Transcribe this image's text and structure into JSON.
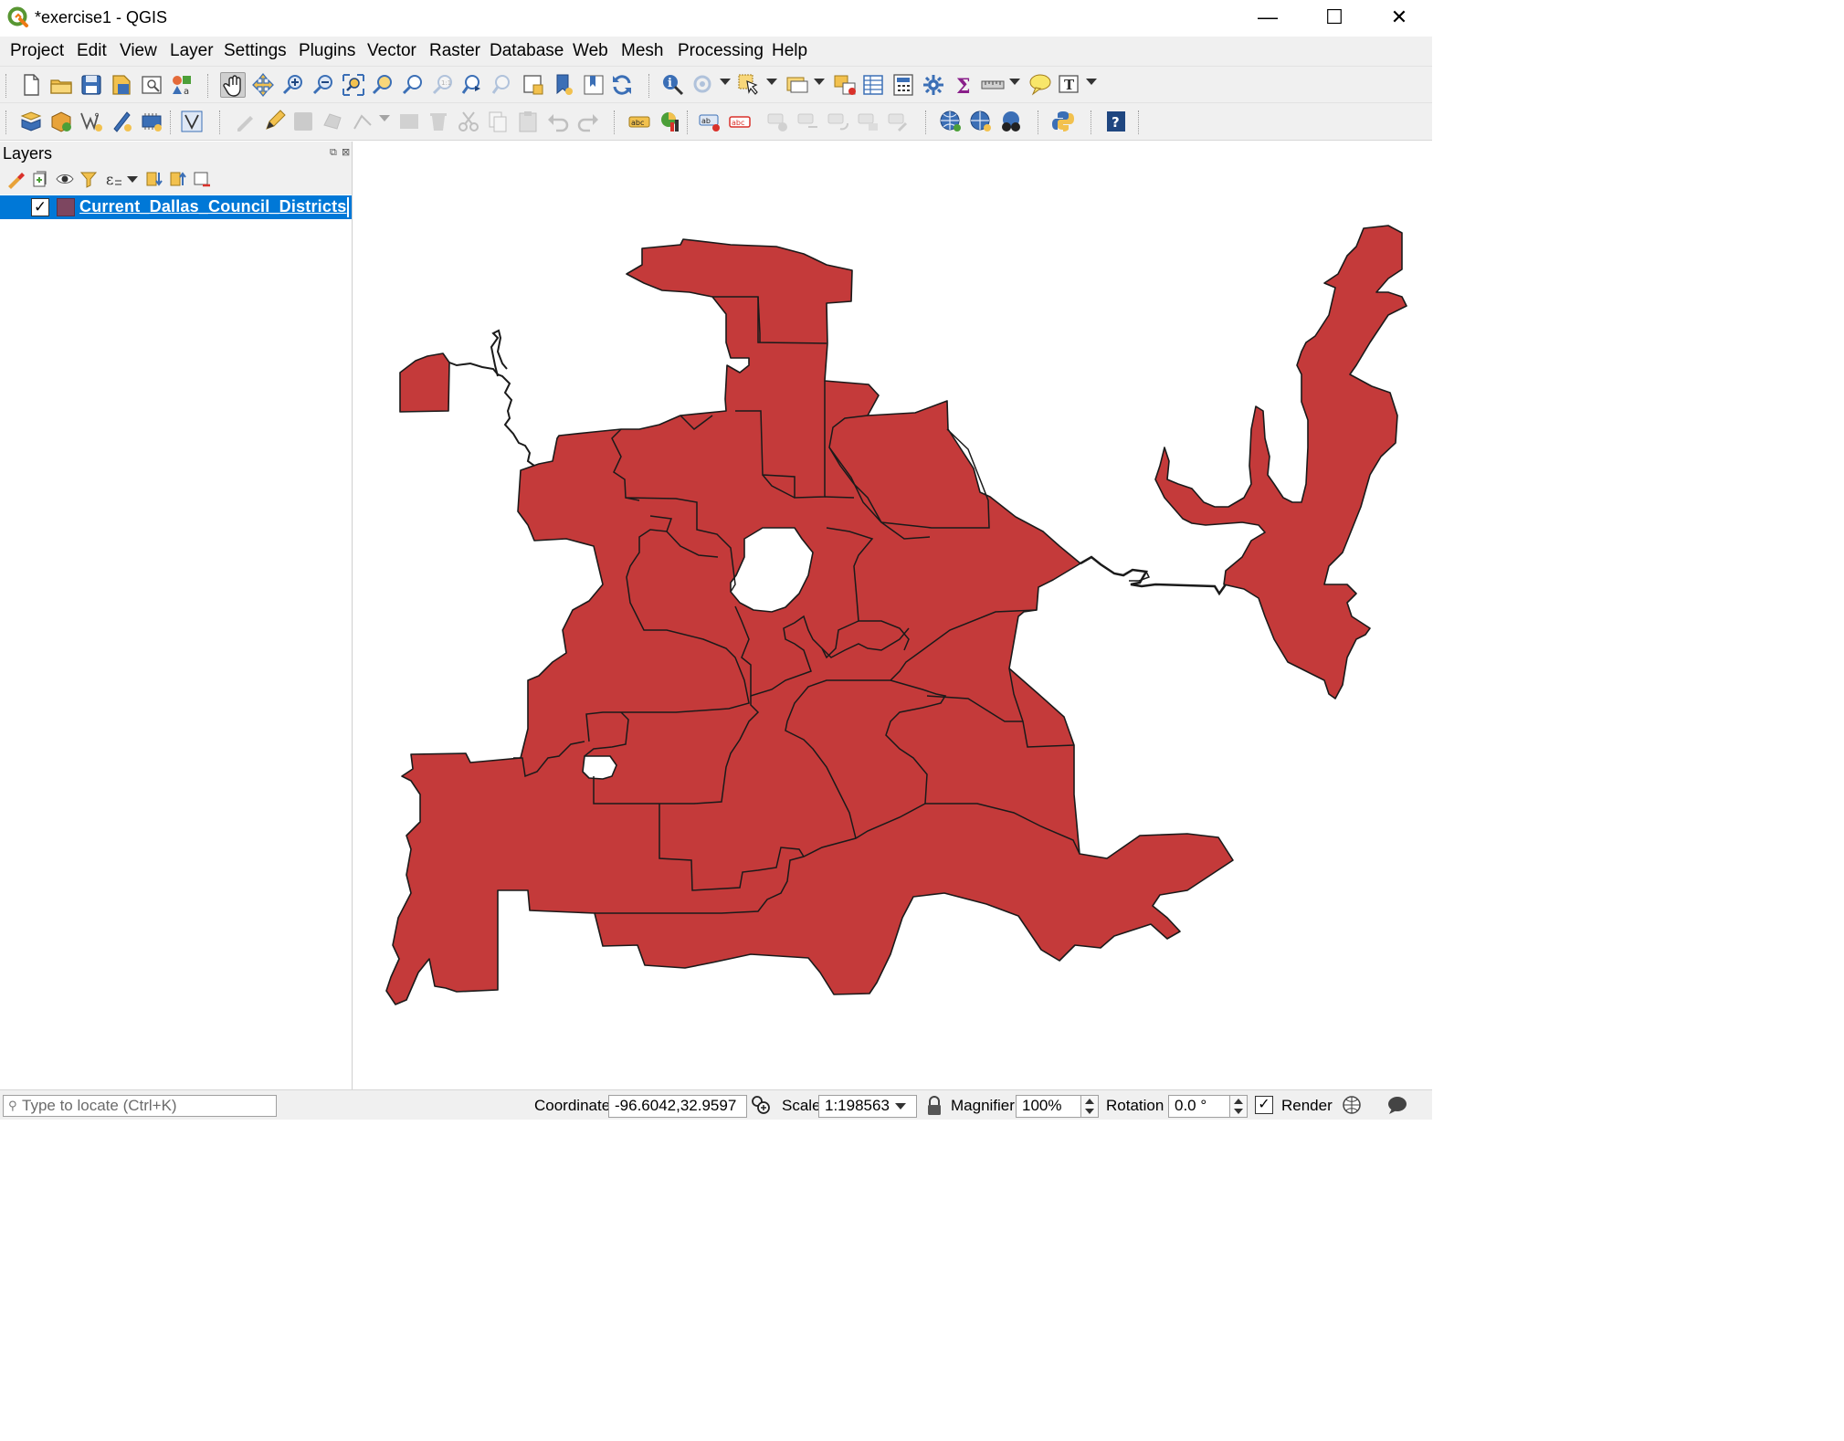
{
  "window": {
    "title": "*exercise1 - QGIS",
    "minimize": "—",
    "maximize": "☐",
    "close": "✕"
  },
  "menu": [
    "Project",
    "Edit",
    "View",
    "Layer",
    "Settings",
    "Plugins",
    "Vector",
    "Raster",
    "Database",
    "Web",
    "Mesh",
    "Processing",
    "Help"
  ],
  "layers_panel": {
    "title": "Layers",
    "layers": [
      {
        "name": "Current_Dallas_Council_Districts",
        "visible": true,
        "symbol_color": "#7d4660"
      }
    ]
  },
  "map": {
    "fill_color": "#c43a3a",
    "stroke_color": "#1a1a1a"
  },
  "statusbar": {
    "locator_placeholder": "Type to locate (Ctrl+K)",
    "coordinate_label": "Coordinate",
    "coordinate_value": "-96.6042,32.9597",
    "scale_label": "Scale",
    "scale_value": "1:198563",
    "magnifier_label": "Magnifier",
    "magnifier_value": "100%",
    "rotation_label": "Rotation",
    "rotation_value": "0.0 °",
    "render_label": "Render",
    "render_checked": true
  },
  "colors": {
    "selection": "#0078d7",
    "chrome": "#f0f0f0"
  }
}
